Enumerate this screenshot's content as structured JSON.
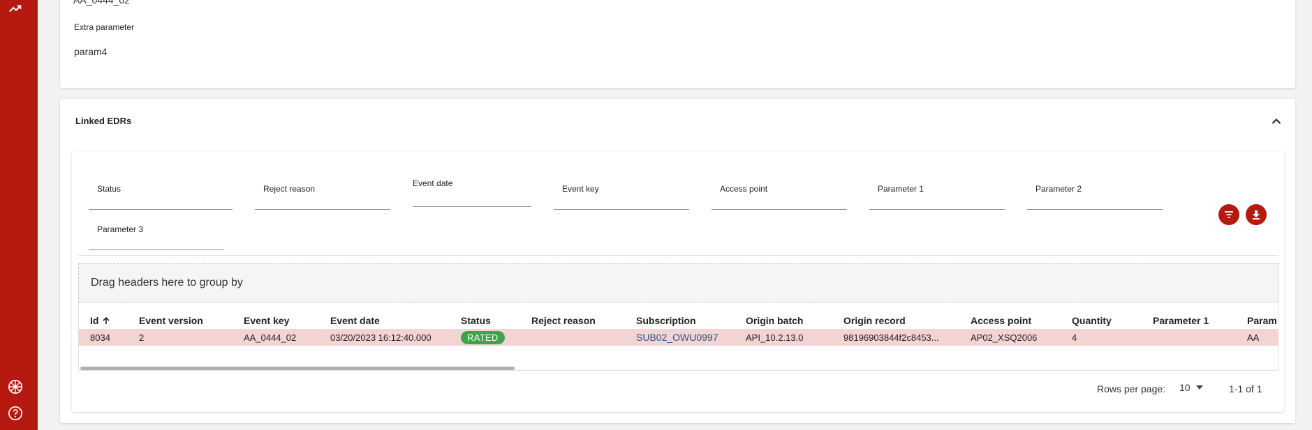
{
  "sidebar": {
    "icons": [
      "trending-up-icon",
      "uk-flag-icon",
      "help-icon"
    ]
  },
  "top_card": {
    "prev_value": "AA_0444_02",
    "extra_label": "Extra parameter",
    "extra_value": "param4"
  },
  "linked": {
    "title": "Linked EDRs"
  },
  "filters": {
    "status": "Status",
    "reject_reason": "Reject reason",
    "event_date": "Event date",
    "event_key": "Event key",
    "access_point": "Access point",
    "parameter_1": "Parameter 1",
    "parameter_2": "Parameter 2",
    "parameter_3": "Parameter 3"
  },
  "group_by": "Drag headers here to group by",
  "table": {
    "headers": {
      "id": "Id",
      "event_version": "Event version",
      "event_key": "Event key",
      "event_date": "Event date",
      "status": "Status",
      "reject_reason": "Reject reason",
      "subscription": "Subscription",
      "origin_batch": "Origin batch",
      "origin_record": "Origin record",
      "access_point": "Access point",
      "quantity": "Quantity",
      "parameter_1": "Parameter 1",
      "parameter_2": "Param"
    },
    "rows": [
      {
        "id": "8034",
        "event_version": "2",
        "event_key": "AA_0444_02",
        "event_date": "03/20/2023 16:12:40.000",
        "status": "RATED",
        "reject_reason": "",
        "subscription": "SUB02_OWU0997",
        "origin_batch": "API_10.2.13.0",
        "origin_record": "98196903844f2c8453...",
        "access_point": "AP02_XSQ2006",
        "quantity": "4",
        "parameter_1": "",
        "parameter_2": "AA"
      }
    ]
  },
  "pagination": {
    "rows_per_page_label": "Rows per page:",
    "rows_per_page_value": "10",
    "range": "1-1 of 1"
  },
  "colors": {
    "brand": "#b5190f",
    "rated": "#3fa34a",
    "row_highlight": "#f2d4d3",
    "link": "#2f4f8f"
  }
}
